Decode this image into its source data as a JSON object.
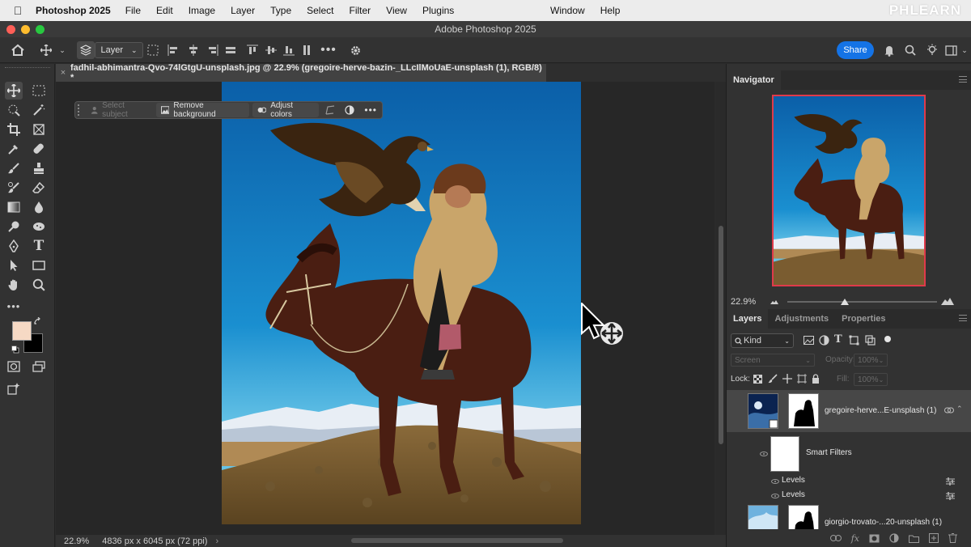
{
  "menubar": {
    "app_name": "Photoshop 2025",
    "menus": [
      "File",
      "Edit",
      "Image",
      "Layer",
      "Type",
      "Select",
      "Filter",
      "View",
      "Plugins"
    ],
    "right_menus": [
      "Window",
      "Help"
    ],
    "watermark": "PHLEARN"
  },
  "window": {
    "title": "Adobe Photoshop 2025"
  },
  "options_bar": {
    "auto_select_target": "Layer",
    "share_label": "Share"
  },
  "document": {
    "tab_title": "fadhil-abhimantra-Qvo-74lGtgU-unsplash.jpg @ 22.9% (gregoire-herve-bazin-_LLcIlMoUaE-unsplash (1), RGB/8) *",
    "zoom": "22.9%",
    "dimensions": "4836 px x 6045 px (72 ppi)"
  },
  "contextual_taskbar": {
    "select_subject": "Select subject",
    "remove_background": "Remove background",
    "adjust_colors": "Adjust colors"
  },
  "colors": {
    "foreground": "#f6d9c4",
    "background": "#000000",
    "accent": "#1473e6"
  },
  "navigator": {
    "tab": "Navigator",
    "zoom": "22.9%"
  },
  "layers_panel": {
    "tabs": [
      "Layers",
      "Adjustments",
      "Properties"
    ],
    "filter_kind": "Kind",
    "blend_mode": "Screen",
    "opacity_label": "Opacity:",
    "opacity_value": "100%",
    "lock_label": "Lock:",
    "fill_label": "Fill:",
    "fill_value": "100%",
    "layers": [
      {
        "name": "gregoire-herve...E-unsplash (1)"
      },
      {
        "name": "Smart Filters"
      },
      {
        "name": "Levels"
      },
      {
        "name": "Levels"
      },
      {
        "name": "giorgio-trovato-...20-unsplash (1)"
      }
    ]
  }
}
